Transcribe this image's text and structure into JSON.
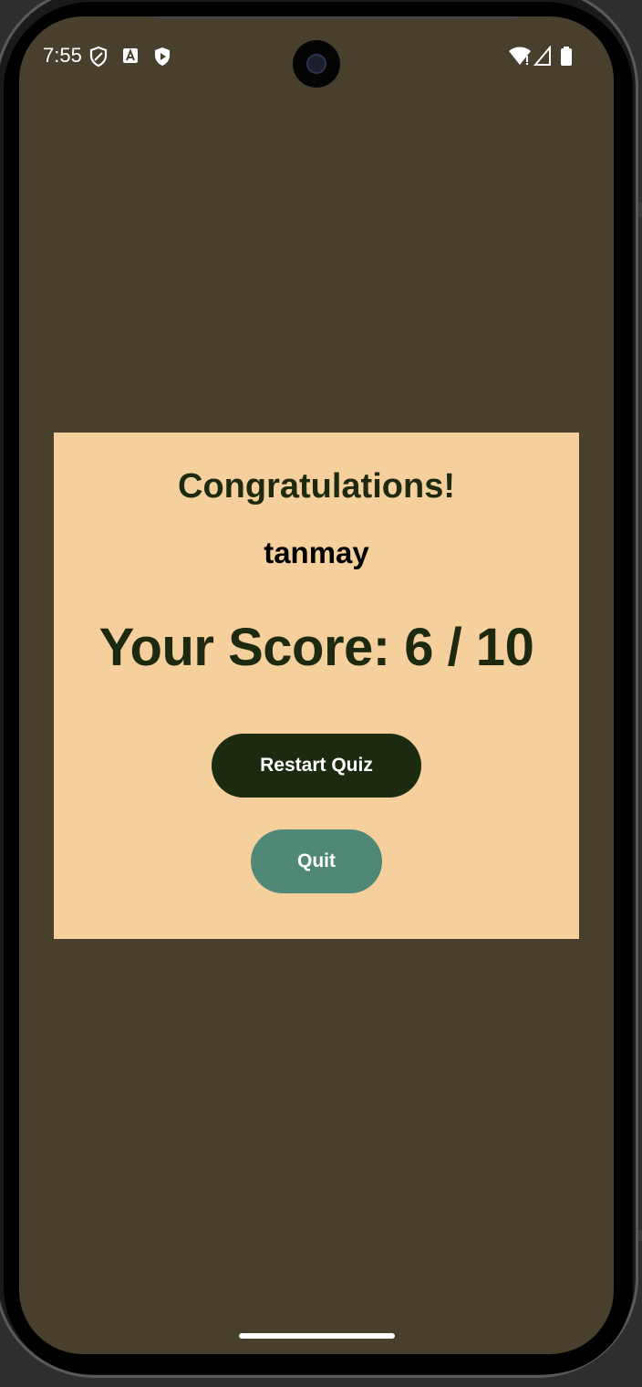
{
  "status_bar": {
    "time": "7:55",
    "icons": [
      "shield-outline-icon",
      "text-a-icon",
      "play-shield-icon",
      "wifi-icon",
      "cell-signal-icon",
      "battery-icon"
    ]
  },
  "result_card": {
    "title": "Congratulations!",
    "username": "tanmay",
    "score_text": "Your Score: 6 / 10"
  },
  "buttons": {
    "restart_label": "Restart Quiz",
    "quit_label": "Quit"
  },
  "colors": {
    "background": "#48402d",
    "card": "#f6d09c",
    "primary_dark": "#1c2a0f",
    "quit_green": "#508877"
  }
}
